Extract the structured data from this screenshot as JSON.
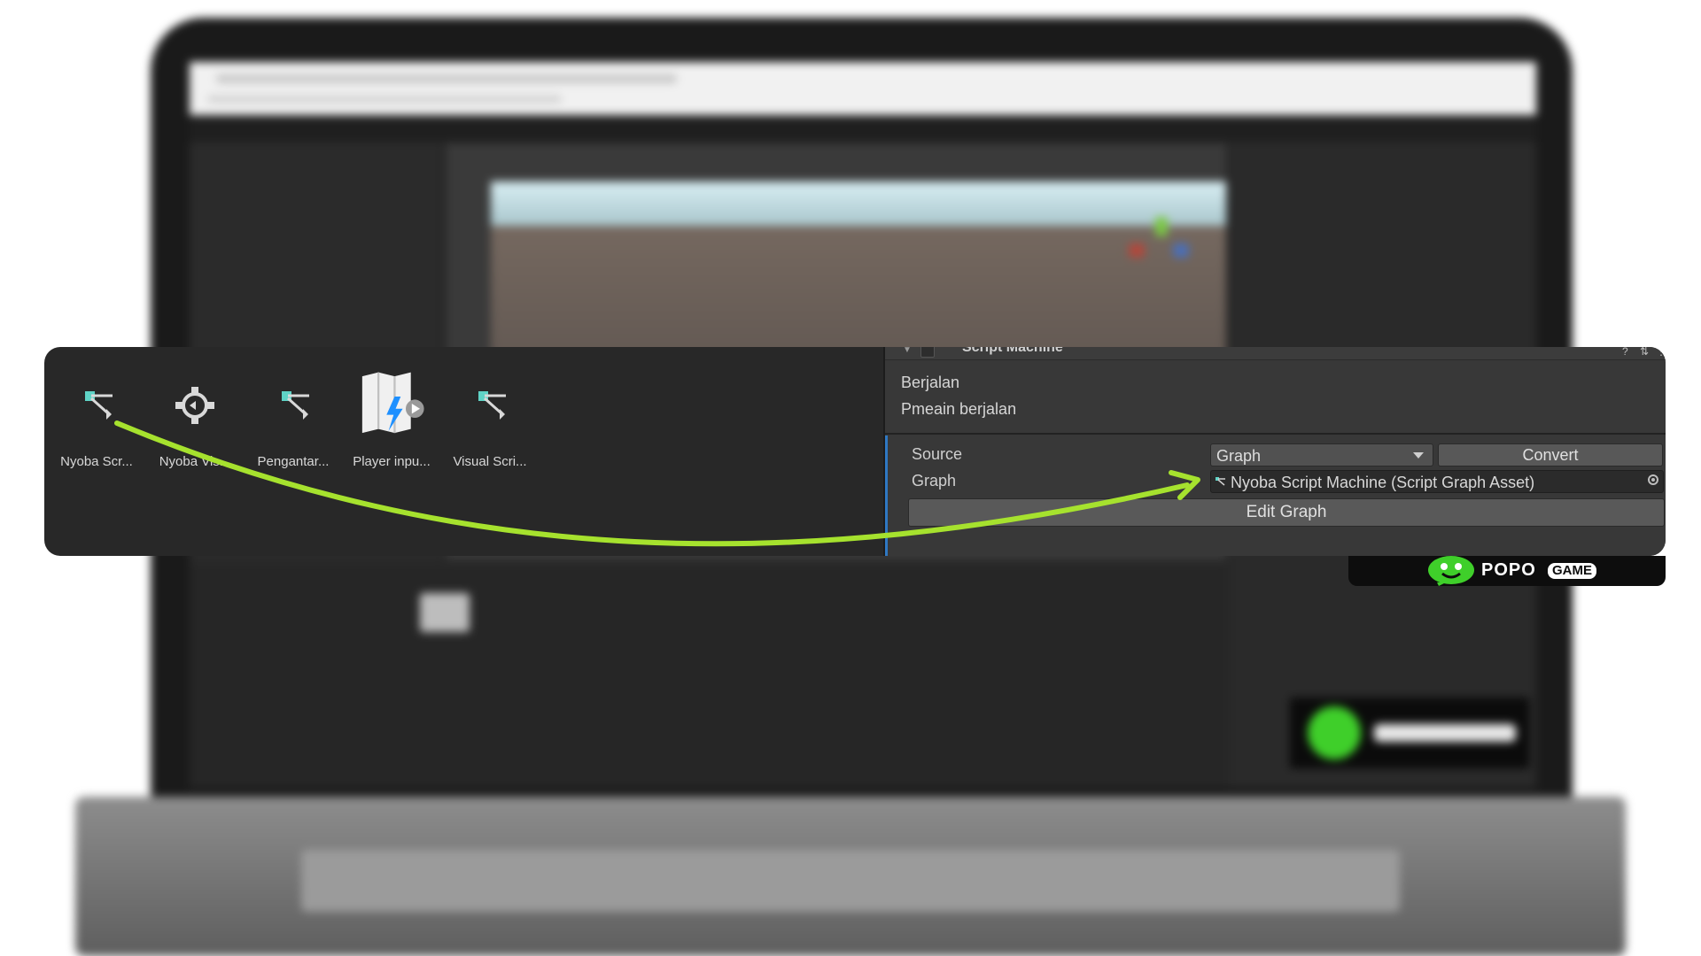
{
  "assets": [
    {
      "label": "Nyoba Scr...",
      "icon": "script-graph-icon"
    },
    {
      "label": "Nyoba Vis...",
      "icon": "state-graph-icon"
    },
    {
      "label": "Pengantar...",
      "icon": "script-graph-icon"
    },
    {
      "label": "Player inpu...",
      "icon": "input-actions-icon"
    },
    {
      "label": "Visual Scri...",
      "icon": "script-graph-icon"
    }
  ],
  "component": {
    "title": "Script Machine",
    "description_title": "Berjalan",
    "description_body": "Pmeain berjalan",
    "source_label": "Source",
    "source_value": "Graph",
    "convert_label": "Convert",
    "graph_label": "Graph",
    "graph_value": "Nyoba Script Machine (Script Graph Asset)",
    "edit_graph_label": "Edit Graph"
  },
  "logo": {
    "text": "POPO",
    "badge": "GAME"
  },
  "colors": {
    "arrow": "#a6e22e",
    "graph_icon": "#5fd3c6",
    "accent": "#2f78c2",
    "logo_green": "#3fcf2a"
  }
}
